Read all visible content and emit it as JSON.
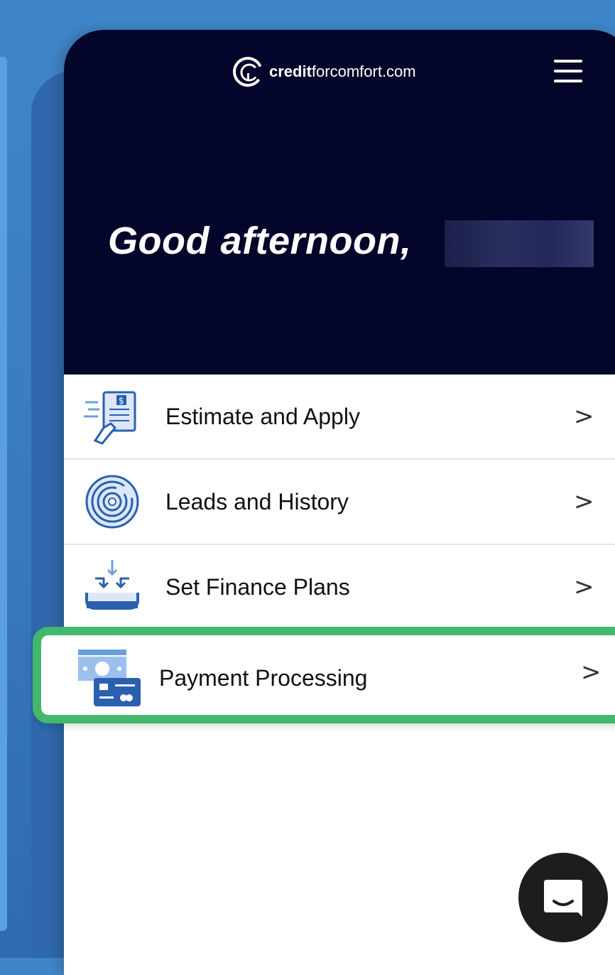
{
  "brand": {
    "name_bold": "credit",
    "name_rest": "forcomfort.com",
    "icon": "c-logo-icon"
  },
  "header": {
    "menu_icon": "hamburger-icon"
  },
  "greeting": {
    "text": "Good afternoon,"
  },
  "menu": {
    "items": [
      {
        "label": "Estimate and Apply",
        "icon": "document-hand-icon",
        "chevron": ">"
      },
      {
        "label": "Leads and History",
        "icon": "target-rings-icon",
        "chevron": ">"
      },
      {
        "label": "Set Finance Plans",
        "icon": "tray-arrows-icon",
        "chevron": ">"
      }
    ],
    "highlighted": {
      "label": "Payment Processing",
      "icon": "cash-card-icon",
      "chevron": ">"
    }
  },
  "chat": {
    "icon": "chat-bubble-icon"
  },
  "colors": {
    "accent_green": "#43b86c",
    "hero_navy": "#03062a",
    "icon_blue": "#2b5fb0",
    "bg_blue": "#3a7cc0"
  }
}
